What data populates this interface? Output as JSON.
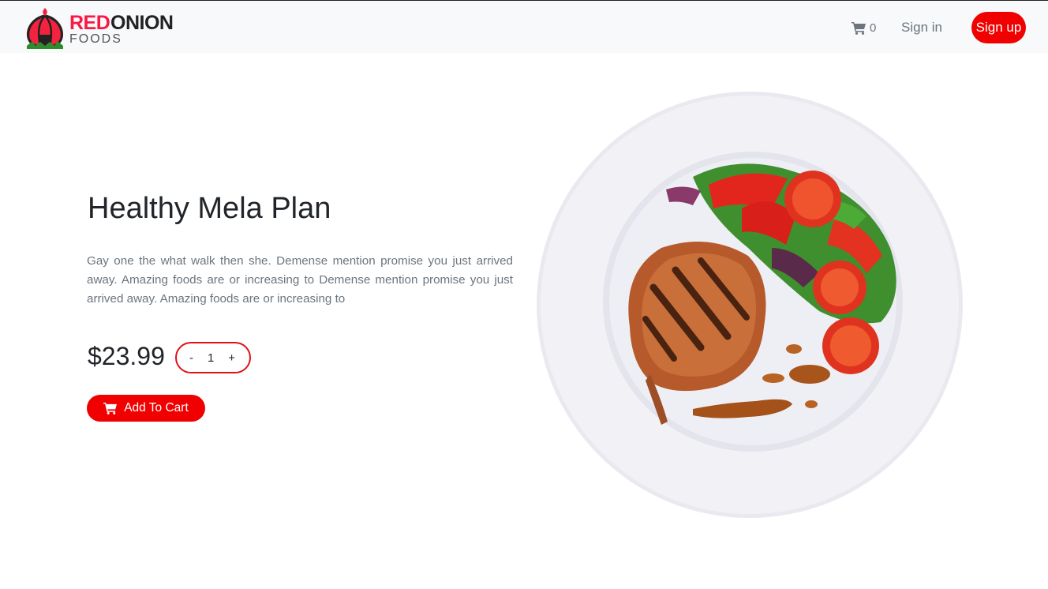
{
  "navbar": {
    "brand": {
      "name_red": "RED",
      "name_dark": "ONION",
      "tagline": "FOODS"
    },
    "cart": {
      "icon": "cart-icon",
      "count": "0"
    },
    "signin_label": "Sign in",
    "signup_label": "Sign up"
  },
  "product": {
    "title": "Healthy Mela Plan",
    "description": "Gay one the what walk then she. Demense mention promise you just arrived away. Amazing foods are or increasing to Demense mention promise you just arrived away. Amazing foods are or increasing to",
    "price": "$23.99",
    "quantity": {
      "minus_label": "-",
      "value": "1",
      "plus_label": "+"
    },
    "add_to_cart_label": "Add To Cart"
  },
  "colors": {
    "accent": "#f00000",
    "brand_red": "#f91944",
    "muted_text": "#6c757d",
    "navbar_bg": "#f8f9fa"
  }
}
